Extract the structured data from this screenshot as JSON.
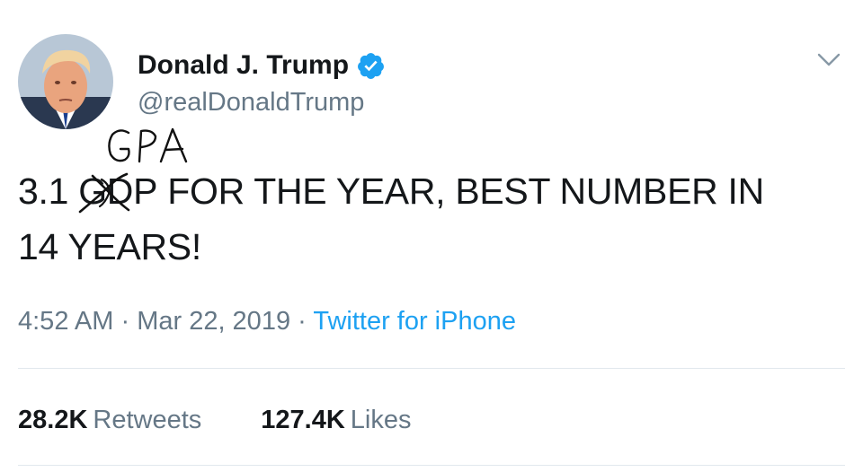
{
  "tweet": {
    "author": {
      "display_name": "Donald J. Trump",
      "handle": "@realDonaldTrump",
      "verified": true,
      "avatar_icon": "profile-photo"
    },
    "text": {
      "number": "3.1",
      "struck_word": "GDP",
      "line1_rest": " FOR THE YEAR, BEST NUMBER IN",
      "line2": "14 YEARS!",
      "handwritten_annotation": "GPA"
    },
    "meta": {
      "time": "4:52 AM",
      "separator": " · ",
      "date": "Mar 22, 2019",
      "source": "Twitter for iPhone"
    },
    "stats": {
      "retweets_count": "28.2K",
      "retweets_label": "Retweets",
      "likes_count": "127.4K",
      "likes_label": "Likes"
    }
  },
  "colors": {
    "text": "#14171a",
    "secondary_text": "#657786",
    "accent": "#1da1f2",
    "divider": "#e1e8ed"
  }
}
